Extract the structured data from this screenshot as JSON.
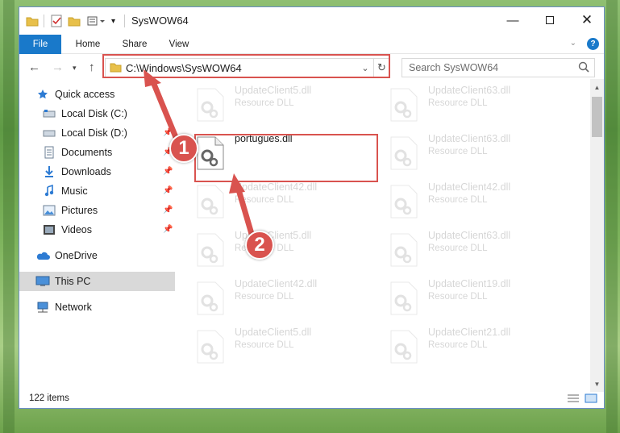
{
  "window": {
    "title": "SysWOW64",
    "controls": [
      "minimize",
      "maximize",
      "close"
    ]
  },
  "ribbon": {
    "tabs": [
      "File",
      "Home",
      "Share",
      "View"
    ]
  },
  "navigation": {
    "address": "C:\\Windows\\SysWOW64",
    "search_placeholder": "Search SysWOW64"
  },
  "sidebar": {
    "quick_access": "Quick access",
    "items": [
      {
        "label": "Local Disk (C:)",
        "icon": "drive-icon",
        "pinned": false
      },
      {
        "label": "Local Disk (D:)",
        "icon": "drive-icon",
        "pinned": true
      },
      {
        "label": "Documents",
        "icon": "documents-icon",
        "pinned": true
      },
      {
        "label": "Downloads",
        "icon": "downloads-icon",
        "pinned": true
      },
      {
        "label": "Music",
        "icon": "music-icon",
        "pinned": true
      },
      {
        "label": "Pictures",
        "icon": "pictures-icon",
        "pinned": true
      },
      {
        "label": "Videos",
        "icon": "videos-icon",
        "pinned": true
      }
    ],
    "onedrive": "OneDrive",
    "this_pc": "This PC",
    "network": "Network"
  },
  "files": [
    {
      "name": "UpdateClient5.dll",
      "type": "Resource DLL",
      "faded": true
    },
    {
      "name": "UpdateClient63.dll",
      "type": "Resource DLL",
      "faded": true
    },
    {
      "name": "portugues.dll",
      "type": "",
      "faded": false
    },
    {
      "name": "UpdateClient63.dll",
      "type": "Resource DLL",
      "faded": true
    },
    {
      "name": "UpdateClient42.dll",
      "type": "Resource DLL",
      "faded": true
    },
    {
      "name": "UpdateClient42.dll",
      "type": "Resource DLL",
      "faded": true
    },
    {
      "name": "UpdateClient5.dll",
      "type": "Resource DLL",
      "faded": true
    },
    {
      "name": "UpdateClient63.dll",
      "type": "Resource DLL",
      "faded": true
    },
    {
      "name": "UpdateClient42.dll",
      "type": "Resource DLL",
      "faded": true
    },
    {
      "name": "UpdateClient19.dll",
      "type": "Resource DLL",
      "faded": true
    },
    {
      "name": "UpdateClient5.dll",
      "type": "Resource DLL",
      "faded": true
    },
    {
      "name": "UpdateClient21.dll",
      "type": "Resource DLL",
      "faded": true
    }
  ],
  "status": {
    "item_count": "122 items"
  },
  "callouts": [
    "1",
    "2"
  ],
  "colors": {
    "accent": "#1979ca",
    "highlight": "#d9534f",
    "selection": "#d9d9d9"
  }
}
